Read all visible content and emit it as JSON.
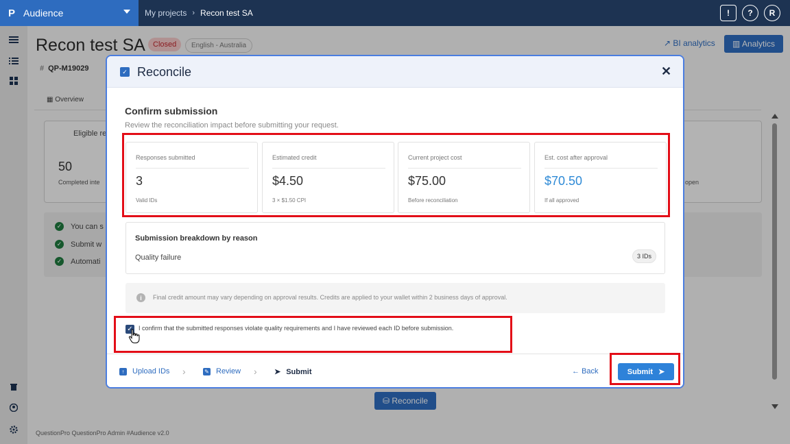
{
  "topbar": {
    "app_name": "Audience",
    "logo": "P",
    "breadcrumb": [
      "My projects",
      "Recon test SA"
    ],
    "icons": [
      "feedback-icon",
      "help-icon",
      "user-avatar"
    ],
    "avatar_initial": "R",
    "help_glyph": "?",
    "feedback_glyph": "!"
  },
  "page": {
    "title": "Recon test SA",
    "status_badge": "Closed",
    "locale_badge": "English - Australia",
    "project_id": "QP-M19029",
    "bi_analytics": "BI analytics",
    "analytics": "Analytics",
    "tab_overview": "Overview",
    "card_title": "Eligible res",
    "card_number": "50",
    "card_sub": "Completed inte",
    "card_sub_right": "open",
    "checks": [
      "You can s",
      "Submit w",
      "Automati"
    ],
    "reconcile_button": "Reconcile",
    "footer": "QuestionPro QuestionPro Admin  #Audience v2.0"
  },
  "modal": {
    "title": "Reconcile",
    "close_glyph": "✕",
    "section_title": "Confirm submission",
    "section_subtitle": "Review the reconciliation impact before submitting your request.",
    "metrics": [
      {
        "label": "Responses submitted",
        "value": "3",
        "note": "Valid IDs",
        "accent": false
      },
      {
        "label": "Estimated credit",
        "value": "$4.50",
        "note": "3 × $1.50 CPI",
        "accent": false
      },
      {
        "label": "Current project cost",
        "value": "$75.00",
        "note": "Before reconciliation",
        "accent": false
      },
      {
        "label": "Est. cost after approval",
        "value": "$70.50",
        "note": "If all approved",
        "accent": true
      }
    ],
    "breakdown": {
      "title": "Submission breakdown by reason",
      "reason": "Quality failure",
      "count": "3 IDs"
    },
    "info_text": "Final credit amount may vary depending on approval results. Credits are applied to your wallet within 2 business days of approval.",
    "confirm_text": "I confirm that the submitted responses violate quality requirements and I have reviewed each ID before submission.",
    "confirm_checked": true,
    "steps": [
      "Upload IDs",
      "Review",
      "Submit"
    ],
    "back_label": "Back",
    "submit_label": "Submit"
  },
  "colors": {
    "topbar": "#1d3352",
    "accent": "#2e6cbf",
    "highlight": "#e30d17",
    "closed_badge": "#c0262d"
  }
}
